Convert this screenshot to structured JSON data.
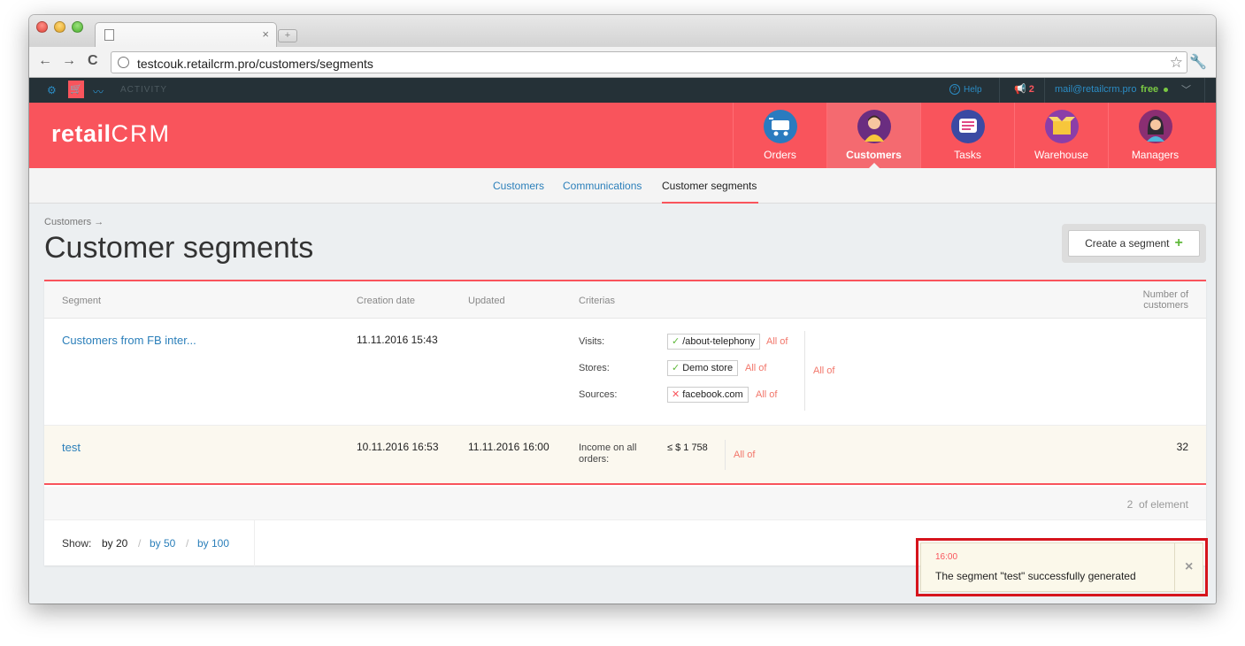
{
  "browser": {
    "tab_close": "×",
    "new_tab": "+",
    "url": "testcouk.retailcrm.pro/customers/segments",
    "back": "←",
    "forward": "→",
    "reload": "C",
    "bookmark": "☆",
    "menu": "🔧"
  },
  "topbar": {
    "activity": "ACTIVITY",
    "help": "Help",
    "notifications_count": "2",
    "email": "mail@retailcrm.pro",
    "plan": "free"
  },
  "header": {
    "logo_text": "retail",
    "logo_crm": "CRM",
    "nav": [
      {
        "label": "Orders",
        "color": "#2a7bbf"
      },
      {
        "label": "Customers",
        "color": "#6a2d80"
      },
      {
        "label": "Tasks",
        "color": "#3b4aa3"
      },
      {
        "label": "Warehouse",
        "color": "#8b3ea8"
      },
      {
        "label": "Managers",
        "color": "#8a2e72"
      }
    ]
  },
  "subnav": {
    "items": [
      "Customers",
      "Communications",
      "Customer segments"
    ]
  },
  "page": {
    "breadcrumb": "Customers →",
    "title": "Customer segments",
    "create_button": "Create a segment",
    "create_plus": "+"
  },
  "table": {
    "columns": {
      "segment": "Segment",
      "creation_date": "Creation date",
      "updated": "Updated",
      "criterias": "Criterias",
      "count_line1": "Number of",
      "count_line2": "customers"
    },
    "rows": [
      {
        "segment": "Customers from FB inter...",
        "created": "11.11.2016 15:43",
        "updated": "",
        "criteria": [
          {
            "label": "Visits:",
            "value": "/about-telephony",
            "state": "include",
            "match": "All of"
          },
          {
            "label": "Stores:",
            "value": "Demo store",
            "state": "include",
            "match": "All of"
          },
          {
            "label": "Sources:",
            "value": "facebook.com",
            "state": "exclude",
            "match": "All of"
          }
        ],
        "group_match": "All of",
        "count": ""
      },
      {
        "segment": "test",
        "created": "10.11.2016 16:53",
        "updated": "11.11.2016 16:00",
        "criteria_label": "Income on all orders:",
        "criteria_value": "≤ $ 1 758",
        "group_match": "All of",
        "count": "32"
      }
    ],
    "total_count": "2",
    "total_suffix": "of element"
  },
  "pager": {
    "show_label": "Show:",
    "options": [
      "by 20",
      "by 50",
      "by 100"
    ],
    "current": "by 20"
  },
  "toast": {
    "time": "16:00",
    "message": "The segment \"test\" successfully generated",
    "close": "×"
  }
}
